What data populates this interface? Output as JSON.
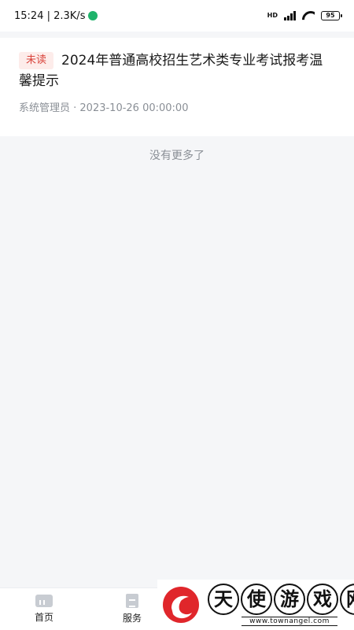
{
  "status_bar": {
    "time_speed": "15:24 | 2.3K/s",
    "hd": "HD",
    "battery": "95"
  },
  "messages": [
    {
      "badge": "未读",
      "title": "2024年普通高校招生艺术类专业考试报考温馨提示",
      "meta": "系统管理员 · 2023-10-26 00:00:00"
    }
  ],
  "list_footer": "没有更多了",
  "bottom_nav": [
    {
      "label": "首页",
      "icon": "home-icon"
    },
    {
      "label": "服务",
      "icon": "document-icon"
    }
  ],
  "watermark": {
    "chars": [
      "天",
      "使",
      "游",
      "戏",
      "网"
    ],
    "url": "www.townangel.com"
  },
  "colors": {
    "badge_bg": "#fdecea",
    "badge_text": "#d9443c",
    "logo_red": "#e0262b"
  }
}
